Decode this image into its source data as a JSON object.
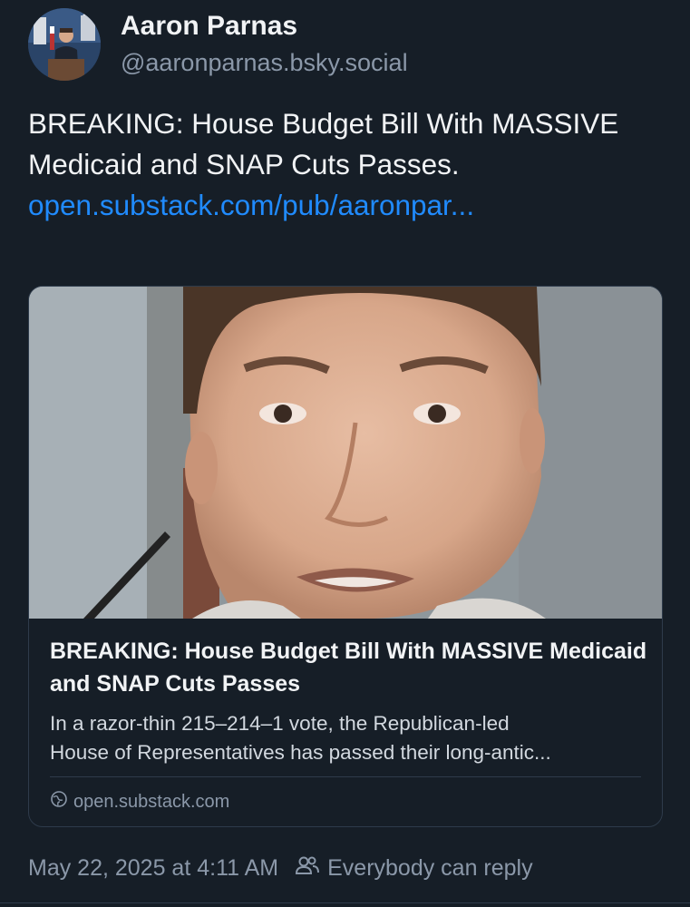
{
  "author": {
    "display_name": "Aaron Parnas",
    "handle": "@aaronparnas.bsky.social",
    "avatar_icon": "profile-photo"
  },
  "post": {
    "text": "BREAKING: House Budget Bill With MASSIVE Medicaid and SNAP Cuts Passes.",
    "link_text": "open.substack.com/pub/aaronpar..."
  },
  "embed": {
    "title": "BREAKING: House Budget Bill With MASSIVE Medicaid and SNAP Cuts Passes",
    "description": "In a razor-thin 215–214–1 vote, the Republican-led\nHouse of Representatives has passed their long-antic...",
    "domain": "open.substack.com",
    "domain_icon": "globe-icon"
  },
  "meta": {
    "timestamp": "May 22, 2025 at 4:11 AM",
    "reply_setting": "Everybody can reply",
    "reply_icon": "people-icon"
  },
  "colors": {
    "background": "#161e27",
    "link": "#208bfe",
    "muted": "#8b98a9",
    "border": "#2e3b4b"
  }
}
